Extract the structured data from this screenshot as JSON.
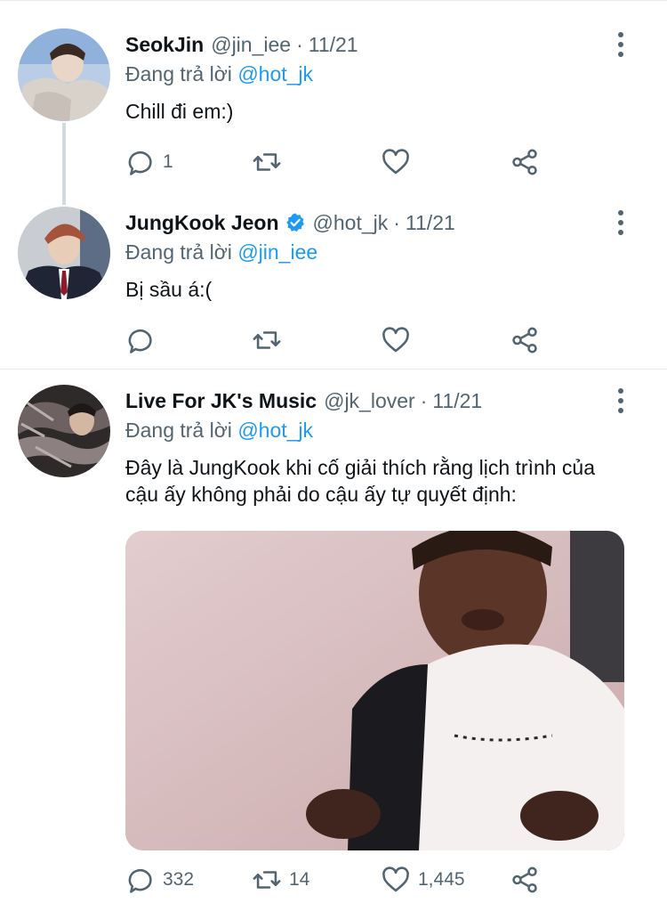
{
  "tweets": [
    {
      "name": "SeokJin",
      "verified": false,
      "handle": "@jin_iee",
      "sep": "·",
      "date": "11/21",
      "replying_prefix": "Đang trả lời",
      "replying_to": "@hot_jk",
      "text": "Chill đi em:)",
      "actions": {
        "replies": "1",
        "retweets": "",
        "likes": ""
      }
    },
    {
      "name": "JungKook Jeon",
      "verified": true,
      "handle": "@hot_jk",
      "sep": "·",
      "date": "11/21",
      "replying_prefix": "Đang trả lời",
      "replying_to": "@jin_iee",
      "text": "Bị sầu á:(",
      "actions": {
        "replies": "",
        "retweets": "",
        "likes": ""
      }
    },
    {
      "name": "Live For JK's Music",
      "verified": false,
      "handle": "@jk_lover",
      "sep": "·",
      "date": "11/21",
      "replying_prefix": "Đang trả lời",
      "replying_to": "@hot_jk",
      "text": "Đây là JungKook khi cố giải thích rằng lịch trình của cậu ấy không phải do cậu ấy tự quyết định:",
      "actions": {
        "replies": "332",
        "retweets": "14",
        "likes": "1,445"
      }
    }
  ],
  "icons": {
    "reply": "reply-icon",
    "retweet": "retweet-icon",
    "like": "heart-icon",
    "share": "share-icon",
    "more": "more-vertical-icon",
    "verified": "verified-badge-icon"
  },
  "colors": {
    "link": "#1d9bf0",
    "secondary_text": "#536471",
    "verified": "#1d9bf0",
    "divider": "#e6ecf0"
  }
}
